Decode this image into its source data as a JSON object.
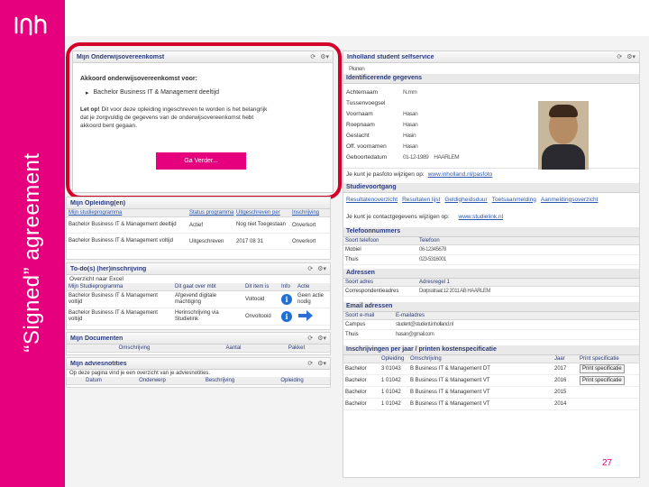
{
  "slide": {
    "vertical_title": "“Signed” agreement",
    "page_number": "27",
    "brand_color": "#e6007e",
    "highlight_color": "#d4002a"
  },
  "left_column": {
    "agreement_panel": {
      "title": "Mijn Onderwijsovereenkomst",
      "heading": "Akkoord onderwijsovereenkomst voor:",
      "program": "Bachelor Business IT & Management deeltijd",
      "warning_label": "Let op!",
      "warning_text_1": "Dit voor deze opleiding ingeschreven te worden is het belangrijk",
      "warning_text_2": "dat je zorgvuldig de gegevens van de onderwijsovereenkomst hebt",
      "warning_text_3": "akkoord bent gegaan.",
      "button_label": "Ga Verder..."
    },
    "opleidingen_panel": {
      "title": "Mijn Opleiding(en)",
      "headers": [
        "Mijn studieprogramma",
        "Status programma",
        "Uitgeschreven per",
        "Inschrijving"
      ],
      "rows": [
        [
          "Bachelor Business IT & Management deeltijd",
          "Actief",
          "Nog niet Toegestaan",
          "Onverkort"
        ],
        [
          "Bachelor Business IT & Management voltijd",
          "Uitgeschreven",
          "2017 08 31",
          "Onverkort"
        ]
      ]
    },
    "todo_panel": {
      "title": "To-do(s) (her)inschrijving",
      "export_link": "Overzicht naar Excel",
      "headers": [
        "Mijn Studieprogramma",
        "Dit gaat over mbt",
        "Dit item is",
        "Info",
        "Actie"
      ],
      "rows": [
        [
          "Bachelor Business IT & Management voltijd",
          "Afgevend digitale machtiging",
          "Voltooid",
          "Geen actie nodig"
        ],
        [
          "Bachelor Business IT & Management voltijd",
          "Herinschrijving via Studielink",
          "Onvoltooid",
          ""
        ]
      ]
    },
    "documenten_panel": {
      "title": "Mijn Documenten",
      "headers": [
        "Omschrijving",
        "Aantal",
        "Pakket"
      ]
    },
    "advies_panel": {
      "title": "Mijn adviesnotities",
      "subtitle": "Op deze pagina vind je een overzicht van je adviesnotities.",
      "headers": [
        "Datum",
        "Onderwerp",
        "Beschrijving",
        "Opleiding"
      ]
    }
  },
  "right_column": {
    "title": "Inholland student selfservice",
    "top_value": "Pionen",
    "identity": {
      "title": "Identificerende gegevens",
      "fields": [
        {
          "label": "Achternaam",
          "value": "N.mm"
        },
        {
          "label": "Tussenvoegsel",
          "value": ""
        },
        {
          "label": "Voornaam",
          "value": "Hasan"
        },
        {
          "label": "Roepnaam",
          "value": "Hasan"
        },
        {
          "label": "Geslacht",
          "value": "Hasin"
        },
        {
          "label": "Off. voornamen",
          "value": "Hasan"
        },
        {
          "label": "Geboortedatum",
          "value": "01-12-1989"
        }
      ],
      "birth_place": "HAARLEM",
      "photo_text": "Je kunt je pasfoto wijzigen op:",
      "photo_link": "www.inholland.nl/pasfoto"
    },
    "studievoortgang": {
      "title": "Studievoortgang",
      "links": [
        "Resultatenoverzicht",
        "Resultaten lijst",
        "Geldigheidsduur",
        "Toetsaanmelding",
        "Aanmeldingsoverzicht"
      ],
      "contact_text": "Je kunt je contactgegevens wijzigen op:",
      "contact_link": "www.studielink.nl"
    },
    "telefoon": {
      "title": "Telefoonnummers",
      "headers": [
        "Soort telefoon",
        "Telefoon"
      ],
      "rows": [
        [
          "Mobiel",
          "06-12345678"
        ],
        [
          "Thuis",
          "023-5316001"
        ]
      ]
    },
    "adressen": {
      "title": "Adressen",
      "headers": [
        "Soort adres",
        "Adresregel 1"
      ],
      "rows": [
        [
          "Correspondentieadres",
          "Dorpsstraat 12 2011 AB HAARLEM"
        ]
      ]
    },
    "email": {
      "title": "Email adressen",
      "headers": [
        "Soort e-mail",
        "E-mailadres"
      ],
      "rows": [
        [
          "Campus",
          "student@student.inholland.nl"
        ],
        [
          "Thuis",
          "hasan@gmail.com"
        ]
      ]
    },
    "inschrijvingen": {
      "title": "Inschrijvingen per jaar / printen kostenspecificatie",
      "headers": [
        "",
        "Opleiding",
        "Omschrijving",
        "Jaar",
        "Print specificatie"
      ],
      "rows": [
        [
          "Bachelor",
          "3 01043",
          "B Business IT & Management DT",
          "2017",
          "Print specificatie"
        ],
        [
          "Bachelor",
          "1 01042",
          "B Business IT & Management VT",
          "2016",
          "Print specificatie"
        ],
        [
          "Bachelor",
          "1 01042",
          "B Business IT & Management VT",
          "2015",
          ""
        ],
        [
          "Bachelor",
          "1 01042",
          "B Business IT & Management VT",
          "2014",
          ""
        ]
      ]
    }
  }
}
